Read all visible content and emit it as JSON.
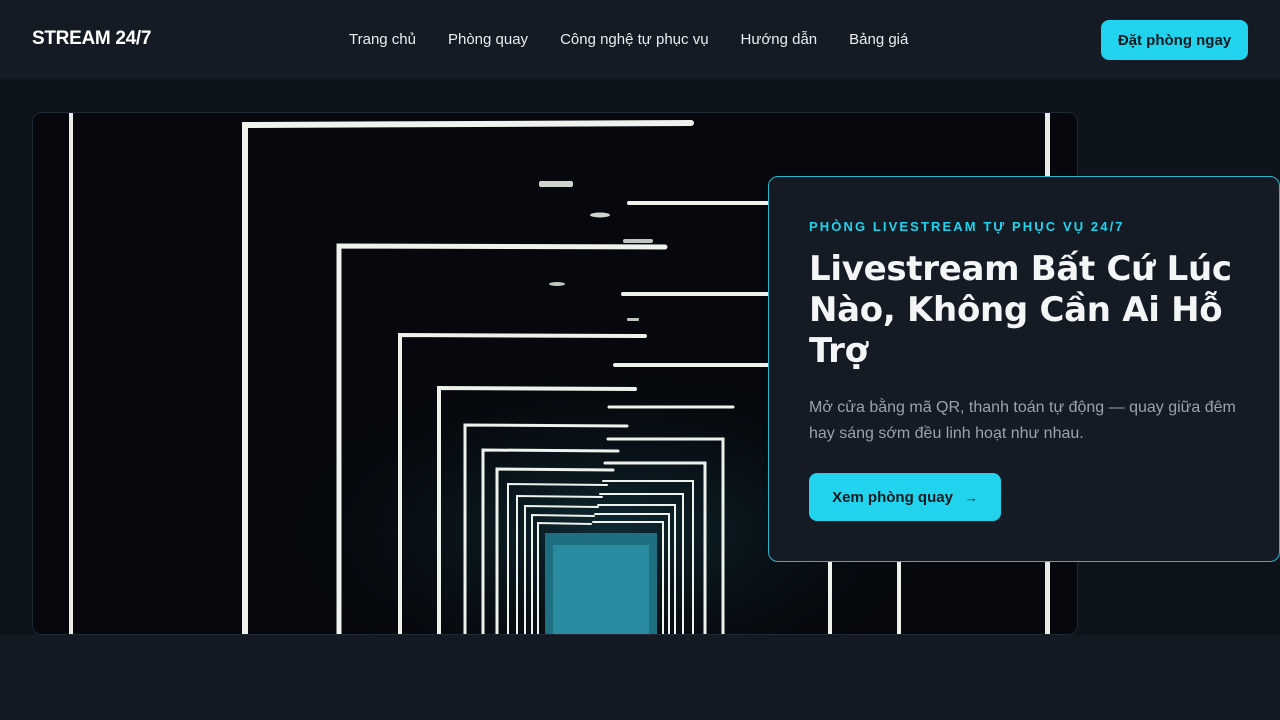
{
  "header": {
    "brand": "STREAM 24/7",
    "nav": [
      "Trang chủ",
      "Phòng quay",
      "Công nghệ tự phục vụ",
      "Hướng dẫn",
      "Bảng giá"
    ],
    "cta": "Đặt phòng ngay"
  },
  "hero": {
    "eyebrow": "PHÒNG LIVESTREAM TỰ PHỤC VỤ 24/7",
    "title": "Livestream Bất Cứ Lúc Nào, Không Cần Ai Hỗ Trợ",
    "description": "Mở cửa bằng mã QR, thanh toán tự động — quay giữa đêm hay sáng sớm đều linh hoạt như nhau.",
    "cta": "Xem phòng quay",
    "cta_icon": "arrow-right-icon",
    "cta_arrow": "→"
  },
  "colors": {
    "accent": "#22d3ee",
    "background": "#131a24"
  }
}
